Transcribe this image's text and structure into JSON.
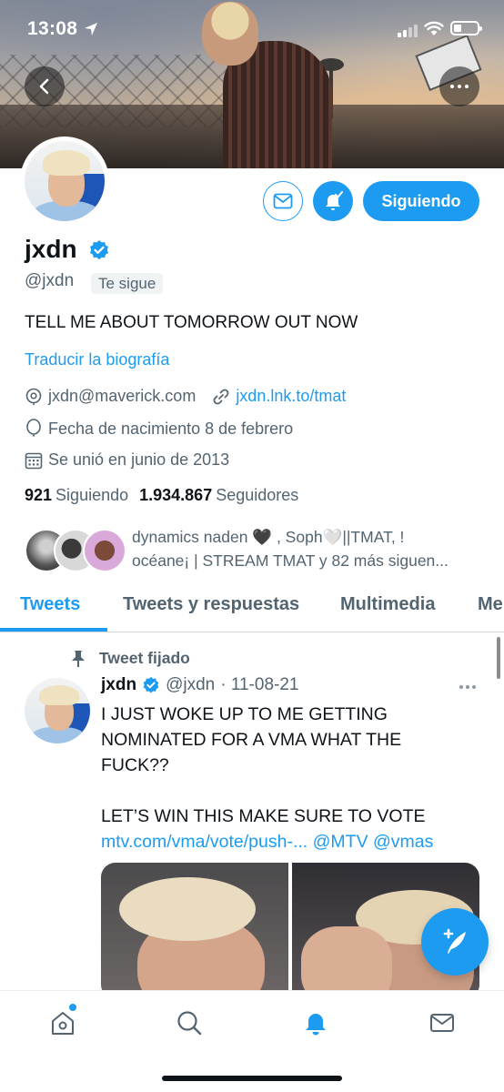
{
  "status_bar": {
    "time": "13:08"
  },
  "profile": {
    "display_name": "jxdn",
    "handle": "@jxdn",
    "follows_you_badge": "Te sigue",
    "bio": "TELL ME ABOUT TOMORROW OUT NOW",
    "translate_bio": "Traducir la biografía",
    "email": "jxdn@maverick.com",
    "link": "jxdn.lnk.to/tmat",
    "birthday": "Fecha de nacimiento 8 de febrero",
    "joined": "Se unió en junio de 2013",
    "following_count": "921",
    "following_label": "Siguiendo",
    "followers_count": "1.934.867",
    "followers_label": "Seguidores",
    "followers_you_know_line1": "dynamics naden 🖤 , Soph🤍||TMAT, !",
    "followers_you_know_line2": "océane¡ | STREAM TMAT y 82 más siguen..."
  },
  "actions": {
    "following_button": "Siguiendo"
  },
  "tabs": [
    {
      "label": "Tweets"
    },
    {
      "label": "Tweets y respuestas"
    },
    {
      "label": "Multimedia"
    },
    {
      "label": "Me"
    }
  ],
  "tweet": {
    "pinned_label": "Tweet fijado",
    "name": "jxdn",
    "handle": "@jxdn",
    "date": "· 11-08-21",
    "line1": "I JUST WOKE UP TO ME GETTING",
    "line2": "NOMINATED FOR A VMA WHAT THE",
    "line3": "FUCK??",
    "line4": "LET’S WIN THIS MAKE SURE TO VOTE",
    "link": "mtv.com/vma/vote/push-...",
    "mention1": "@MTV",
    "mention2": "@vmas"
  },
  "colors": {
    "accent": "#1d9bf0",
    "text_primary": "#0f1419",
    "text_secondary": "#536471"
  },
  "icons": {
    "back": "chevron-left-icon",
    "more": "more-horizontal-icon",
    "message": "mail-icon",
    "bell": "bell-check-icon",
    "verified": "verified-badge-icon",
    "email": "at-sign-icon",
    "link": "link-icon",
    "birthday": "balloon-icon",
    "calendar": "calendar-icon",
    "pin": "pin-icon",
    "compose": "compose-tweet-icon",
    "nav_home": "home-icon",
    "nav_search": "search-icon",
    "nav_notifications": "bell-icon",
    "nav_messages": "mail-icon"
  }
}
